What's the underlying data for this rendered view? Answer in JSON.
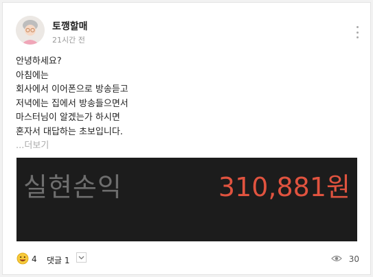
{
  "post": {
    "author": "토깽할매",
    "time": "21시간 전",
    "lines": [
      "안녕하세요?",
      "아침에는",
      "회사에서 이어폰으로 방송듣고",
      "저녁에는 집에서 방송들으면서",
      "마스터님이 알겠는가 하시면",
      "혼자서 대답하는 초보입니다."
    ],
    "more_label": "...더보기",
    "image": {
      "label": "실현손익",
      "value": "310,881원",
      "value_color": "#e0533f"
    }
  },
  "footer": {
    "reaction_count": "4",
    "comment_label": "댓글 1",
    "view_count": "30"
  },
  "icons": [
    "more-vertical-icon",
    "smile-emoji-icon",
    "chevron-down-icon",
    "eye-icon"
  ]
}
